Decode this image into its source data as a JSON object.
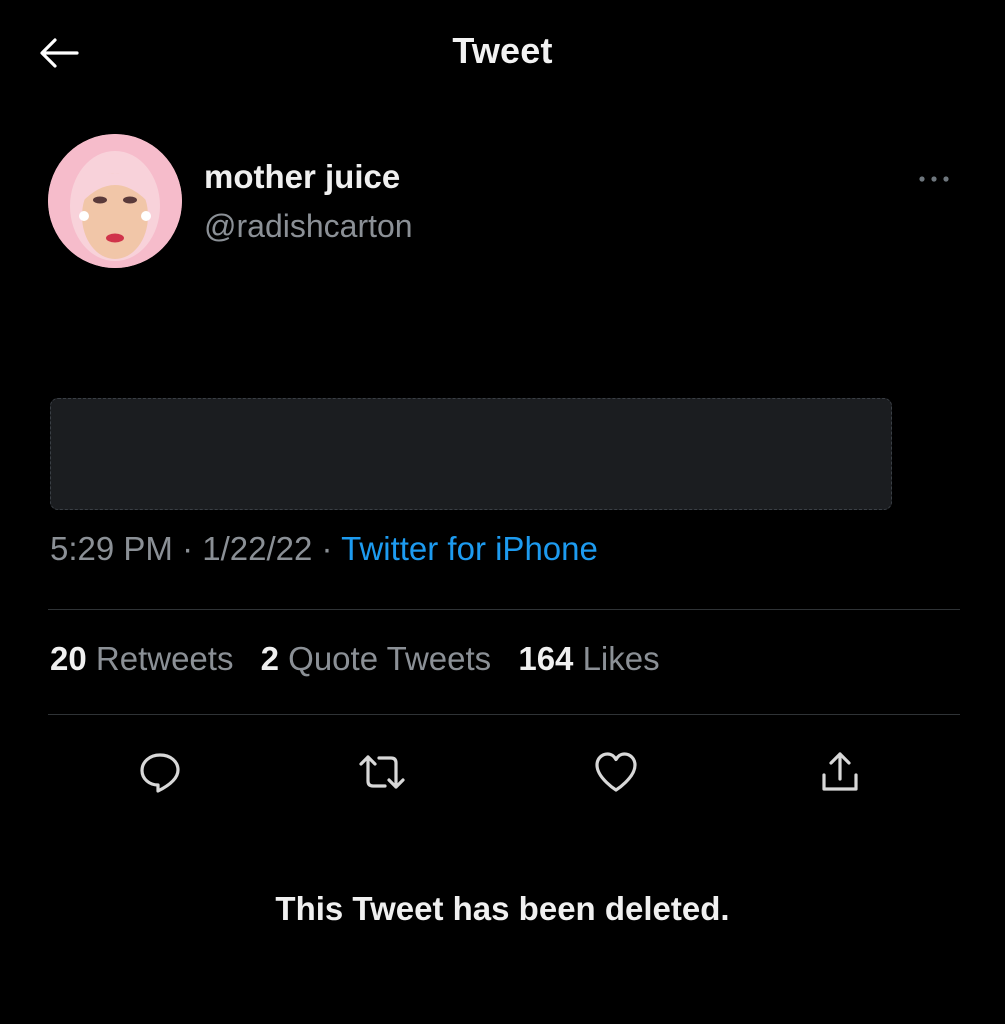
{
  "header": {
    "title": "Tweet",
    "back_icon": "back-arrow-icon"
  },
  "author": {
    "name": "mother juice",
    "handle": "@radishcarton",
    "avatar_bg": "#f4b8c8"
  },
  "tweet": {
    "time": "5:29 PM",
    "date": "1/22/22",
    "source": "Twitter for iPhone"
  },
  "stats": {
    "retweets_count": "20",
    "retweets_label": "Retweets",
    "quotes_count": "2",
    "quotes_label": "Quote Tweets",
    "likes_count": "164",
    "likes_label": "Likes"
  },
  "actions": [
    "reply-icon",
    "retweet-icon",
    "like-icon",
    "share-icon"
  ],
  "notice": "This Tweet has been deleted.",
  "colors": {
    "background": "#000000",
    "primary_text": "#e7e9ea",
    "secondary_text": "#8b9096",
    "link": "#1d9bf0",
    "divider": "#2f3336"
  }
}
